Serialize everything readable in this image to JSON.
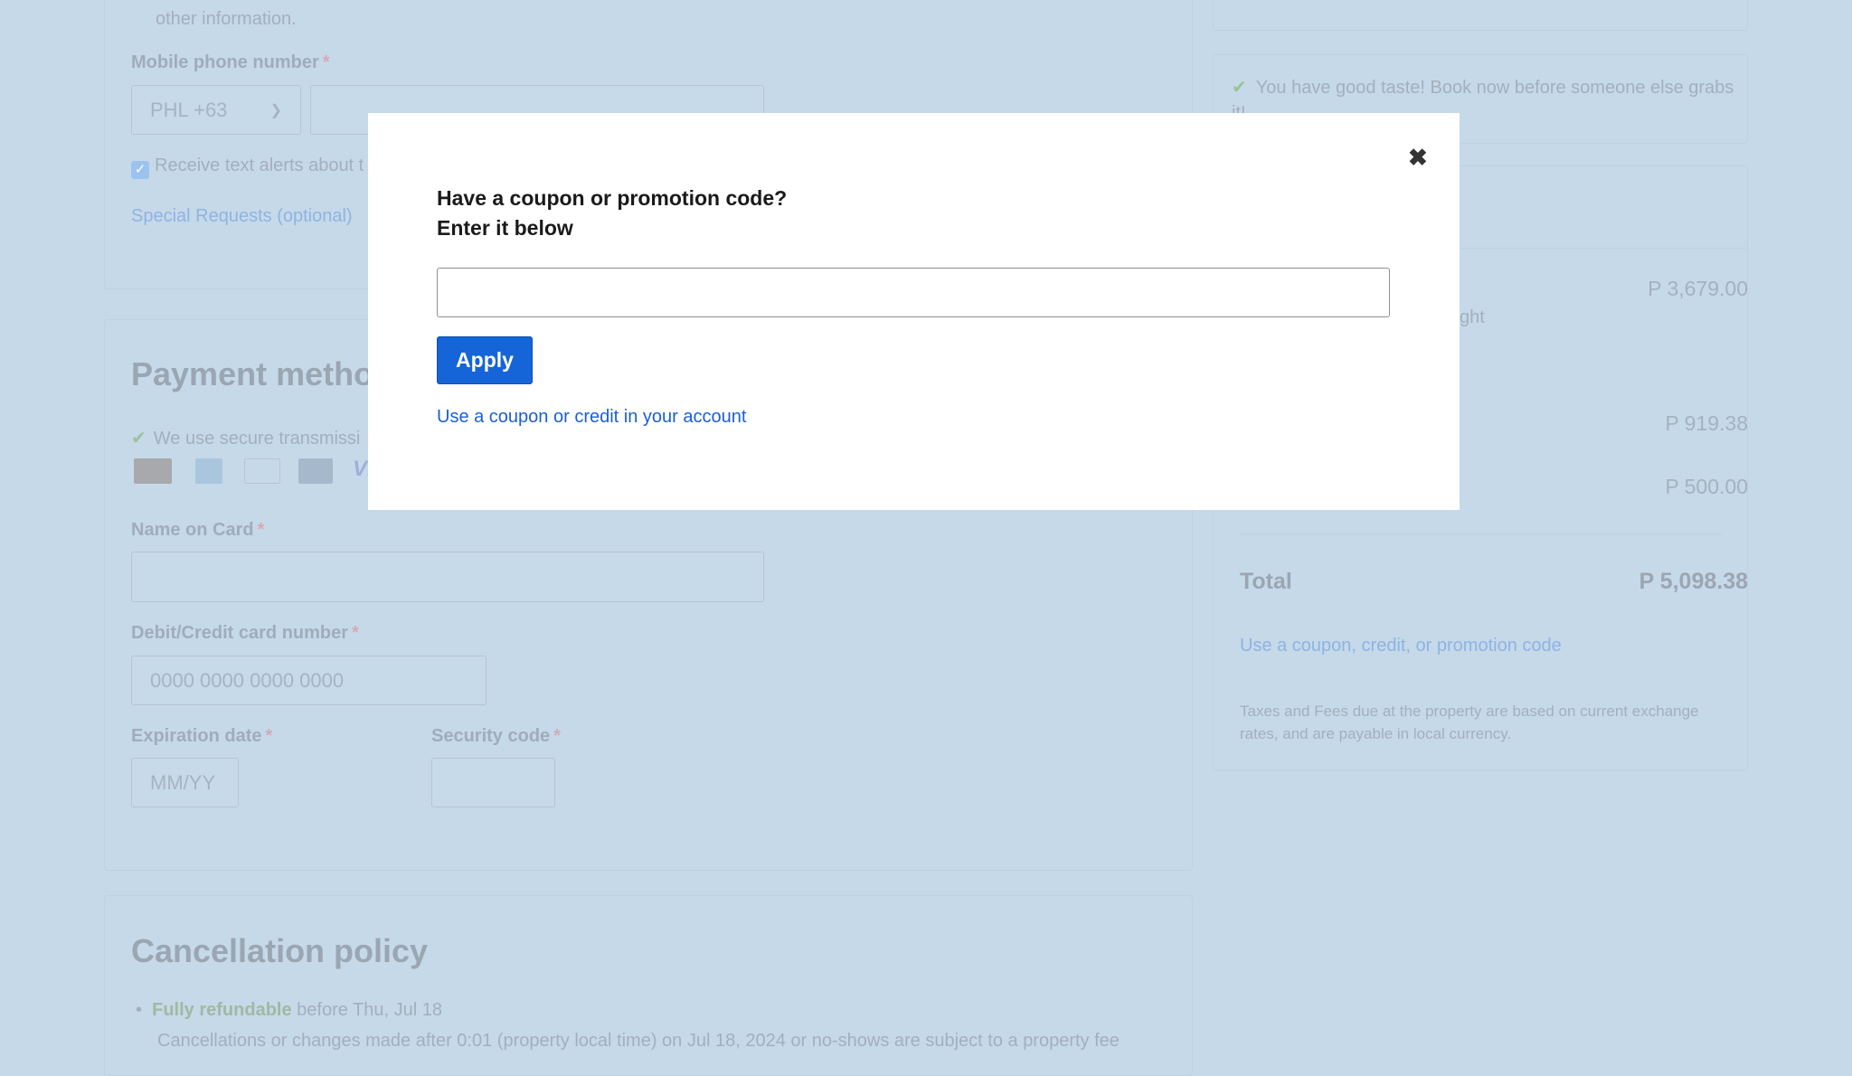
{
  "contact": {
    "info_text_tail": "other information.",
    "mobile_label": "Mobile phone number",
    "country_code": "PHL +63",
    "phone_value": "",
    "text_alerts_label": "Receive text alerts about t",
    "special_requests": "Special Requests (optional)"
  },
  "payment": {
    "title": "Payment metho",
    "secure_text": "We use secure transmissi",
    "card_icons": [
      "mastercard-icon",
      "amex-icon",
      "diners-club-icon",
      "jcb-icon",
      "visa-icon"
    ],
    "visa_partial": "VI",
    "name_label": "Name on Card",
    "card_number_label": "Debit/Credit card number",
    "card_number_placeholder": "0000 0000 0000 0000",
    "expiration_label": "Expiration date",
    "expiration_placeholder": "MM/YY",
    "security_label": "Security code",
    "required_mark": "*"
  },
  "cancellation": {
    "title": "Cancellation policy",
    "bullet_bold": "Fully refundable",
    "bullet_rest": " before Thu, Jul 18",
    "next_line": "Cancellations or changes made after 0:01 (property local time) on Jul 18, 2024 or no-shows are subject to a property fee"
  },
  "summary": {
    "taste_message": "You have good taste! Book now before someone else grabs it!",
    "price_room": "P 3,679.00",
    "per_night_partial": "ght",
    "price_taxes": "P 919.38",
    "price_fees": "P 500.00",
    "total_label": "Total",
    "total_value": "P 5,098.38",
    "coupon_link": "Use a coupon, credit, or promotion code",
    "tax_note": "Taxes and Fees due at the property are based on current exchange rates, and are payable in local currency."
  },
  "modal": {
    "title_line1": "Have a coupon or promotion code?",
    "title_line2": "Enter it below",
    "code_value": "",
    "apply_label": "Apply",
    "account_link": "Use a coupon or credit in your account",
    "close_icon": "close-icon"
  },
  "colors": {
    "accent": "#1565d8",
    "overlay": "#c6d9e9",
    "link": "#1a5fd6"
  }
}
